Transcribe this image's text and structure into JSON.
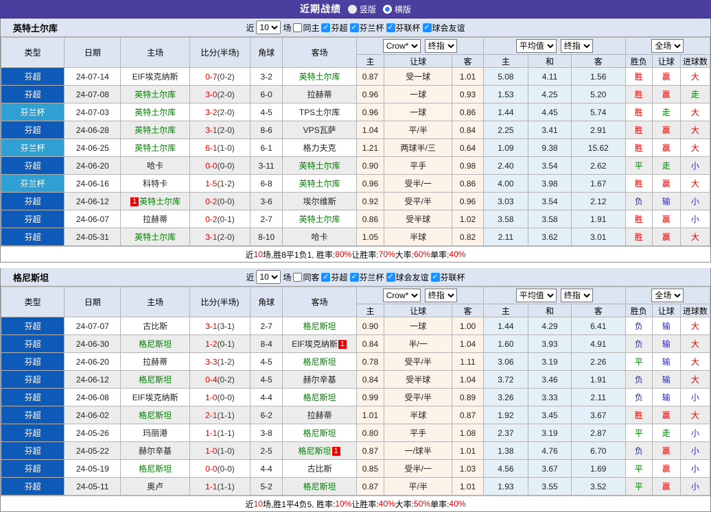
{
  "topbar": {
    "title": "近期战绩",
    "vertical_label": "竖版",
    "horizontal_label": "横版"
  },
  "filter_common": {
    "near": "近",
    "count": "10",
    "games": "场"
  },
  "table_header": {
    "type": "类型",
    "date": "日期",
    "home": "主场",
    "score": "比分(半场)",
    "corner": "角球",
    "away": "客场",
    "sel_crow": "Crow*",
    "sel_final1": "终指",
    "sel_avg": "平均值",
    "sel_final2": "终指",
    "sel_full": "全场",
    "sub": [
      "主",
      "让球",
      "客",
      "主",
      "和",
      "客",
      "胜负",
      "让球",
      "进球数"
    ]
  },
  "colors": {
    "topbar": "#4a3f9f",
    "league": {
      "芬超": "#0d5ab8",
      "芬兰杯": "#30a0d2"
    },
    "result": {
      "r": "#e60000",
      "g": "#008000",
      "b": "#2525cd"
    },
    "team_highlight": "#008000",
    "score_red": "#e60000",
    "checkbox_blue": "#1e90ff"
  },
  "sections": [
    {
      "team": "英特土尔库",
      "same_label": "同主",
      "leagues": [
        "芬超",
        "芬兰杯",
        "芬联杯",
        "球会友谊"
      ],
      "rows": [
        {
          "league": "芬超",
          "date": "24-07-14",
          "home": {
            "name": "EIF埃克纳斯"
          },
          "score": "0-7",
          "half": "(0-2)",
          "corner": "3-2",
          "away": {
            "name": "英特土尔库",
            "green": true
          },
          "crow": [
            "0.87",
            "受一球",
            "1.01"
          ],
          "avg": [
            "5.08",
            "4.11",
            "1.56"
          ],
          "res": [
            [
              "胜",
              "r"
            ],
            [
              "赢",
              "r"
            ],
            [
              "大",
              "r"
            ]
          ]
        },
        {
          "league": "芬超",
          "date": "24-07-08",
          "home": {
            "name": "英特土尔库",
            "green": true
          },
          "score": "3-0",
          "half": "(2-0)",
          "corner": "6-0",
          "away": {
            "name": "拉赫蒂"
          },
          "crow": [
            "0.96",
            "一球",
            "0.93"
          ],
          "avg": [
            "1.53",
            "4.25",
            "5.20"
          ],
          "res": [
            [
              "胜",
              "r"
            ],
            [
              "赢",
              "r"
            ],
            [
              "走",
              "g"
            ]
          ]
        },
        {
          "league": "芬兰杯",
          "date": "24-07-03",
          "home": {
            "name": "英特土尔库",
            "green": true
          },
          "score": "3-2",
          "half": "(2-0)",
          "corner": "4-5",
          "away": {
            "name": "TPS土尔库"
          },
          "crow": [
            "0.96",
            "一球",
            "0.86"
          ],
          "avg": [
            "1.44",
            "4.45",
            "5.74"
          ],
          "res": [
            [
              "胜",
              "r"
            ],
            [
              "走",
              "g"
            ],
            [
              "大",
              "r"
            ]
          ]
        },
        {
          "league": "芬超",
          "date": "24-06-28",
          "home": {
            "name": "英特土尔库",
            "green": true
          },
          "score": "3-1",
          "half": "(2-0)",
          "corner": "8-6",
          "away": {
            "name": "VPS瓦萨"
          },
          "crow": [
            "1.04",
            "平/半",
            "0.84"
          ],
          "avg": [
            "2.25",
            "3.41",
            "2.91"
          ],
          "res": [
            [
              "胜",
              "r"
            ],
            [
              "赢",
              "r"
            ],
            [
              "大",
              "r"
            ]
          ]
        },
        {
          "league": "芬兰杯",
          "date": "24-06-25",
          "home": {
            "name": "英特土尔库",
            "green": true
          },
          "score": "6-1",
          "half": "(1-0)",
          "corner": "6-1",
          "away": {
            "name": "格力夫克"
          },
          "crow": [
            "1.21",
            "两球半/三",
            "0.64"
          ],
          "avg": [
            "1.09",
            "9.38",
            "15.62"
          ],
          "res": [
            [
              "胜",
              "r"
            ],
            [
              "赢",
              "r"
            ],
            [
              "大",
              "r"
            ]
          ]
        },
        {
          "league": "芬超",
          "date": "24-06-20",
          "home": {
            "name": "哈卡"
          },
          "score": "0-0",
          "half": "(0-0)",
          "corner": "3-11",
          "away": {
            "name": "英特土尔库",
            "green": true
          },
          "crow": [
            "0.90",
            "平手",
            "0.98"
          ],
          "avg": [
            "2.40",
            "3.54",
            "2.62"
          ],
          "res": [
            [
              "平",
              "g"
            ],
            [
              "走",
              "g"
            ],
            [
              "小",
              "b"
            ]
          ]
        },
        {
          "league": "芬兰杯",
          "date": "24-06-16",
          "home": {
            "name": "科特卡"
          },
          "score": "1-5",
          "half": "(1-2)",
          "corner": "6-8",
          "away": {
            "name": "英特土尔库",
            "green": true
          },
          "crow": [
            "0.96",
            "受半/一",
            "0.86"
          ],
          "avg": [
            "4.00",
            "3.98",
            "1.67"
          ],
          "res": [
            [
              "胜",
              "r"
            ],
            [
              "赢",
              "r"
            ],
            [
              "大",
              "r"
            ]
          ]
        },
        {
          "league": "芬超",
          "date": "24-06-12",
          "home": {
            "name": "英特土尔库",
            "green": true,
            "card": "1"
          },
          "score": "0-2",
          "half": "(0-0)",
          "corner": "3-6",
          "away": {
            "name": "埃尔维斯"
          },
          "crow": [
            "0.92",
            "受平/半",
            "0.96"
          ],
          "avg": [
            "3.03",
            "3.54",
            "2.12"
          ],
          "res": [
            [
              "负",
              "b"
            ],
            [
              "输",
              "b"
            ],
            [
              "小",
              "b"
            ]
          ]
        },
        {
          "league": "芬超",
          "date": "24-06-07",
          "home": {
            "name": "拉赫蒂"
          },
          "score": "0-2",
          "half": "(0-1)",
          "corner": "2-7",
          "away": {
            "name": "英特土尔库",
            "green": true
          },
          "crow": [
            "0.86",
            "受半球",
            "1.02"
          ],
          "avg": [
            "3.58",
            "3.58",
            "1.91"
          ],
          "res": [
            [
              "胜",
              "r"
            ],
            [
              "赢",
              "r"
            ],
            [
              "小",
              "b"
            ]
          ]
        },
        {
          "league": "芬超",
          "date": "24-05-31",
          "home": {
            "name": "英特土尔库",
            "green": true
          },
          "score": "3-1",
          "half": "(2-0)",
          "corner": "8-10",
          "away": {
            "name": "哈卡"
          },
          "crow": [
            "1.05",
            "半球",
            "0.82"
          ],
          "avg": [
            "2.11",
            "3.62",
            "3.01"
          ],
          "res": [
            [
              "胜",
              "r"
            ],
            [
              "赢",
              "r"
            ],
            [
              "大",
              "r"
            ]
          ]
        }
      ],
      "summary": [
        {
          "t": "近"
        },
        {
          "t": "10",
          "red": true
        },
        {
          "t": "场,胜8平1负1, 胜率:"
        },
        {
          "t": "80%",
          "red": true
        },
        {
          "t": " 让胜率:"
        },
        {
          "t": "70%",
          "red": true
        },
        {
          "t": " 大率:"
        },
        {
          "t": "60%",
          "red": true
        },
        {
          "t": " 单率:"
        },
        {
          "t": "40%",
          "red": true
        }
      ]
    },
    {
      "team": "格尼斯坦",
      "same_label": "同客",
      "leagues": [
        "芬超",
        "芬兰杯",
        "球会友谊",
        "芬联杯"
      ],
      "rows": [
        {
          "league": "芬超",
          "date": "24-07-07",
          "home": {
            "name": "古比斯"
          },
          "score": "3-1",
          "half": "(3-1)",
          "corner": "2-7",
          "away": {
            "name": "格尼斯坦",
            "green": true
          },
          "crow": [
            "0.90",
            "一球",
            "1.00"
          ],
          "avg": [
            "1.44",
            "4.29",
            "6.41"
          ],
          "res": [
            [
              "负",
              "b"
            ],
            [
              "输",
              "b"
            ],
            [
              "大",
              "r"
            ]
          ]
        },
        {
          "league": "芬超",
          "date": "24-06-30",
          "home": {
            "name": "格尼斯坦",
            "green": true
          },
          "score": "1-2",
          "half": "(0-1)",
          "corner": "8-4",
          "away": {
            "name": "EIF埃克纳斯",
            "card": "1"
          },
          "crow": [
            "0.84",
            "半/一",
            "1.04"
          ],
          "avg": [
            "1.60",
            "3.93",
            "4.91"
          ],
          "res": [
            [
              "负",
              "b"
            ],
            [
              "输",
              "b"
            ],
            [
              "大",
              "r"
            ]
          ]
        },
        {
          "league": "芬超",
          "date": "24-06-20",
          "home": {
            "name": "拉赫蒂"
          },
          "score": "3-3",
          "half": "(1-2)",
          "corner": "4-5",
          "away": {
            "name": "格尼斯坦",
            "green": true
          },
          "crow": [
            "0.78",
            "受平/半",
            "1.11"
          ],
          "avg": [
            "3.06",
            "3.19",
            "2.26"
          ],
          "res": [
            [
              "平",
              "g"
            ],
            [
              "输",
              "b"
            ],
            [
              "大",
              "r"
            ]
          ]
        },
        {
          "league": "芬超",
          "date": "24-06-12",
          "home": {
            "name": "格尼斯坦",
            "green": true
          },
          "score": "0-4",
          "half": "(0-2)",
          "corner": "4-5",
          "away": {
            "name": "赫尔辛基"
          },
          "crow": [
            "0.84",
            "受半球",
            "1.04"
          ],
          "avg": [
            "3.72",
            "3.46",
            "1.91"
          ],
          "res": [
            [
              "负",
              "b"
            ],
            [
              "输",
              "b"
            ],
            [
              "大",
              "r"
            ]
          ]
        },
        {
          "league": "芬超",
          "date": "24-06-08",
          "home": {
            "name": "EIF埃克纳斯"
          },
          "score": "1-0",
          "half": "(0-0)",
          "corner": "4-4",
          "away": {
            "name": "格尼斯坦",
            "green": true
          },
          "crow": [
            "0.99",
            "受平/半",
            "0.89"
          ],
          "avg": [
            "3.26",
            "3.33",
            "2.11"
          ],
          "res": [
            [
              "负",
              "b"
            ],
            [
              "输",
              "b"
            ],
            [
              "小",
              "b"
            ]
          ]
        },
        {
          "league": "芬超",
          "date": "24-06-02",
          "home": {
            "name": "格尼斯坦",
            "green": true
          },
          "score": "2-1",
          "half": "(1-1)",
          "corner": "6-2",
          "away": {
            "name": "拉赫蒂"
          },
          "crow": [
            "1.01",
            "半球",
            "0.87"
          ],
          "avg": [
            "1.92",
            "3.45",
            "3.67"
          ],
          "res": [
            [
              "胜",
              "r"
            ],
            [
              "赢",
              "r"
            ],
            [
              "大",
              "r"
            ]
          ]
        },
        {
          "league": "芬超",
          "date": "24-05-26",
          "home": {
            "name": "玛丽港"
          },
          "score": "1-1",
          "half": "(1-1)",
          "corner": "3-8",
          "away": {
            "name": "格尼斯坦",
            "green": true
          },
          "crow": [
            "0.80",
            "平手",
            "1.08"
          ],
          "avg": [
            "2.37",
            "3.19",
            "2.87"
          ],
          "res": [
            [
              "平",
              "g"
            ],
            [
              "走",
              "g"
            ],
            [
              "小",
              "b"
            ]
          ]
        },
        {
          "league": "芬超",
          "date": "24-05-22",
          "home": {
            "name": "赫尔辛基"
          },
          "score": "1-0",
          "half": "(1-0)",
          "corner": "2-5",
          "away": {
            "name": "格尼斯坦",
            "green": true,
            "card": "1"
          },
          "crow": [
            "0.87",
            "一/球半",
            "1.01"
          ],
          "avg": [
            "1.38",
            "4.76",
            "6.70"
          ],
          "res": [
            [
              "负",
              "b"
            ],
            [
              "赢",
              "r"
            ],
            [
              "小",
              "b"
            ]
          ]
        },
        {
          "league": "芬超",
          "date": "24-05-19",
          "home": {
            "name": "格尼斯坦",
            "green": true
          },
          "score": "0-0",
          "half": "(0-0)",
          "corner": "4-4",
          "away": {
            "name": "古比斯"
          },
          "crow": [
            "0.85",
            "受半/一",
            "1.03"
          ],
          "avg": [
            "4.56",
            "3.67",
            "1.69"
          ],
          "res": [
            [
              "平",
              "g"
            ],
            [
              "赢",
              "r"
            ],
            [
              "小",
              "b"
            ]
          ]
        },
        {
          "league": "芬超",
          "date": "24-05-11",
          "home": {
            "name": "奥卢"
          },
          "score": "1-1",
          "half": "(1-1)",
          "corner": "5-2",
          "away": {
            "name": "格尼斯坦",
            "green": true
          },
          "crow": [
            "0.87",
            "平/半",
            "1.01"
          ],
          "avg": [
            "1.93",
            "3.55",
            "3.52"
          ],
          "res": [
            [
              "平",
              "g"
            ],
            [
              "赢",
              "r"
            ],
            [
              "小",
              "b"
            ]
          ]
        }
      ],
      "summary": [
        {
          "t": "近"
        },
        {
          "t": "10",
          "red": true
        },
        {
          "t": "场,胜1平4负5, 胜率:"
        },
        {
          "t": "10%",
          "red": true
        },
        {
          "t": " 让胜率:"
        },
        {
          "t": "40%",
          "red": true
        },
        {
          "t": " 大率:"
        },
        {
          "t": "50%",
          "red": true
        },
        {
          "t": " 单率:"
        },
        {
          "t": "40%",
          "red": true
        }
      ]
    }
  ]
}
